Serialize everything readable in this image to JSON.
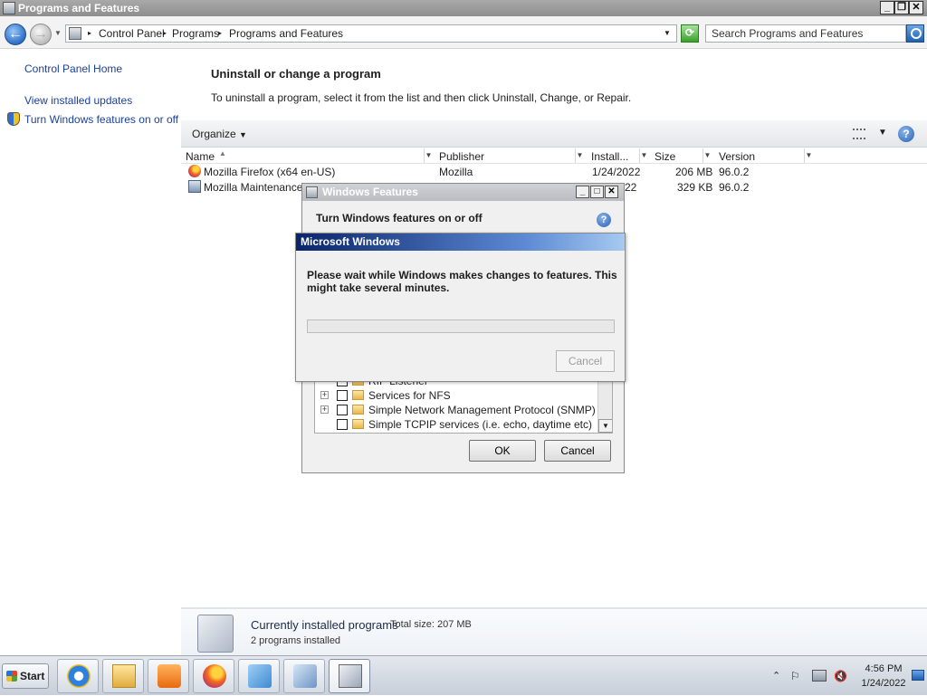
{
  "window": {
    "title": "Programs and Features"
  },
  "address": {
    "crumbs": [
      "Control Panel",
      "Programs",
      "Programs and Features"
    ],
    "search_placeholder": "Search Programs and Features"
  },
  "left_pane": {
    "links": [
      "Control Panel Home",
      "View installed updates",
      "Turn Windows features on or off"
    ]
  },
  "main": {
    "heading": "Uninstall or change a program",
    "description": "To uninstall a program, select it from the list and then click Uninstall, Change, or Repair."
  },
  "toolbar": {
    "organize_label": "Organize"
  },
  "table": {
    "columns": [
      "Name",
      "Publisher",
      "Install...",
      "Size",
      "Version"
    ],
    "rows": [
      {
        "name": "Mozilla Firefox (x64 en-US)",
        "publisher": "Mozilla",
        "installed": "1/24/2022",
        "size": "206 MB",
        "version": "96.0.2"
      },
      {
        "name": "Mozilla Maintenance Se",
        "publisher": "",
        "installed": "22",
        "size": "329 KB",
        "version": "96.0.2"
      }
    ]
  },
  "features_dialog": {
    "title": "Windows Features",
    "heading": "Turn Windows features on or off",
    "items": [
      "RIP Listener",
      "Services for NFS",
      "Simple Network Management Protocol (SNMP)",
      "Simple TCPIP services (i.e. echo, daytime etc)"
    ],
    "ok_label": "OK",
    "cancel_label": "Cancel"
  },
  "progress_dialog": {
    "title": "Microsoft Windows",
    "message": "Please wait while Windows makes changes to features. This might take several minutes.",
    "progress": 0,
    "cancel_label": "Cancel"
  },
  "details": {
    "title": "Currently installed programs",
    "total": "Total size: 207 MB",
    "count": "2 programs installed"
  },
  "taskbar": {
    "start_label": "Start",
    "time": "4:56 PM",
    "date": "1/24/2022"
  }
}
